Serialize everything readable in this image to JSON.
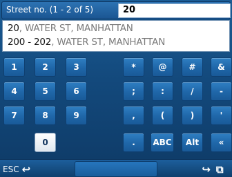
{
  "header": {
    "label": "Street no. (1 - 2 of 5)",
    "input_value": "20"
  },
  "results": [
    {
      "number": "20",
      "rest": ", WATER ST, MANHATTAN"
    },
    {
      "number": "200 - 202",
      "rest": ", WATER ST, MANHATTAN"
    }
  ],
  "keys": {
    "k1": "1",
    "k2": "2",
    "k3": "3",
    "k4": "4",
    "k5": "5",
    "k6": "6",
    "k7": "7",
    "k8": "8",
    "k9": "9",
    "k0": "0",
    "asterisk": "*",
    "at": "@",
    "hash": "#",
    "amp": "&",
    "semicolon": ";",
    "colon": ":",
    "slash": "/",
    "dash": "-",
    "comma": ",",
    "lparen": "(",
    "rparen": ")",
    "apostrophe": "'",
    "period": ".",
    "abc": "ABC",
    "alt": "Alt",
    "laquo": "«"
  },
  "footer": {
    "esc_label": "ESC",
    "esc_arrow": "↩",
    "next_arrow": "↪",
    "pages_icon": "⧉"
  }
}
